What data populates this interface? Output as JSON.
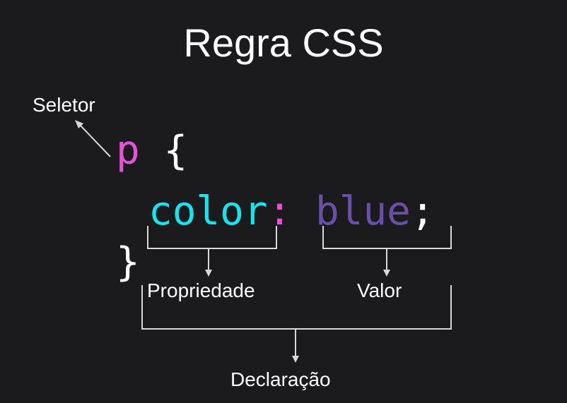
{
  "title": "Regra CSS",
  "code": {
    "selector": "p",
    "open_brace": "{",
    "property": "color",
    "colon": ":",
    "value": "blue",
    "semicolon": ";",
    "close_brace": "}"
  },
  "labels": {
    "selector": "Seletor",
    "property": "Propriedade",
    "value": "Valor",
    "declaration": "Declaração"
  },
  "colors": {
    "background": "#1b1b1d",
    "selector": "#e552d8",
    "property": "#14e6ee",
    "colon": "#e552d8",
    "value": "#6a4fa8",
    "text": "#ffffff",
    "lines": "#d8d8d8"
  }
}
